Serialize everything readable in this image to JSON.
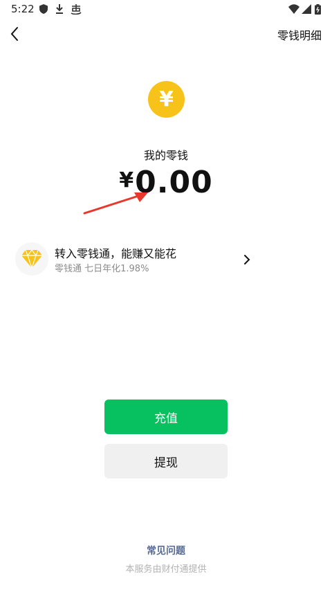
{
  "status_bar": {
    "time": "5:22",
    "icons": [
      "shield-icon",
      "download-icon",
      "app-icon",
      "wifi-icon",
      "signal-icon",
      "battery-icon"
    ]
  },
  "nav": {
    "back_icon": "chevron-left-icon",
    "detail_link": "零钱明细"
  },
  "balance": {
    "coin_symbol": "¥",
    "label": "我的零钱",
    "currency": "¥",
    "amount": "0.00"
  },
  "promo": {
    "title": "转入零钱通，能赚又能花",
    "subtitle": "零钱通 七日年化1.98%",
    "icon": "diamond-icon",
    "chevron_icon": "chevron-right-icon"
  },
  "actions": {
    "recharge": "充值",
    "withdraw": "提现"
  },
  "footer": {
    "faq": "常见问题",
    "provider": "本服务由财付通提供"
  },
  "colors": {
    "accent_green": "#07c160",
    "coin_yellow": "#f7c21a",
    "annotation_red": "#e8372c",
    "link_blue": "#576b95"
  }
}
